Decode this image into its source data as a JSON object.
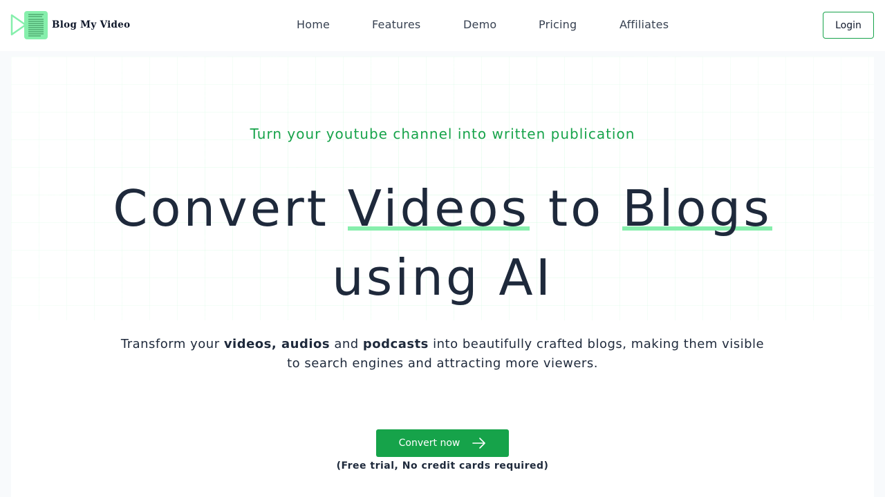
{
  "brand": {
    "name": "Blog My Video",
    "accent_color": "#16a34a",
    "highlight_color": "#86efac"
  },
  "nav": {
    "items": [
      {
        "label": "Home"
      },
      {
        "label": "Features"
      },
      {
        "label": "Demo"
      },
      {
        "label": "Pricing"
      },
      {
        "label": "Affiliates"
      }
    ],
    "login_label": "Login"
  },
  "hero": {
    "tagline": "Turn your youtube channel into written publication",
    "headline": {
      "part1": "Convert ",
      "highlight1": "Videos",
      "part2": " to ",
      "highlight2": "Blogs",
      "part3": "using AI"
    },
    "description": {
      "pre": "Transform your ",
      "bold1": "videos, audios",
      "mid": " and ",
      "bold2": "podcasts",
      "post": " into beautifully crafted blogs, making them visible to search engines and attracting more viewers."
    },
    "cta_label": "Convert now",
    "cta_icon": "arrow-right-icon",
    "note": "(Free trial, No credit cards required)"
  }
}
